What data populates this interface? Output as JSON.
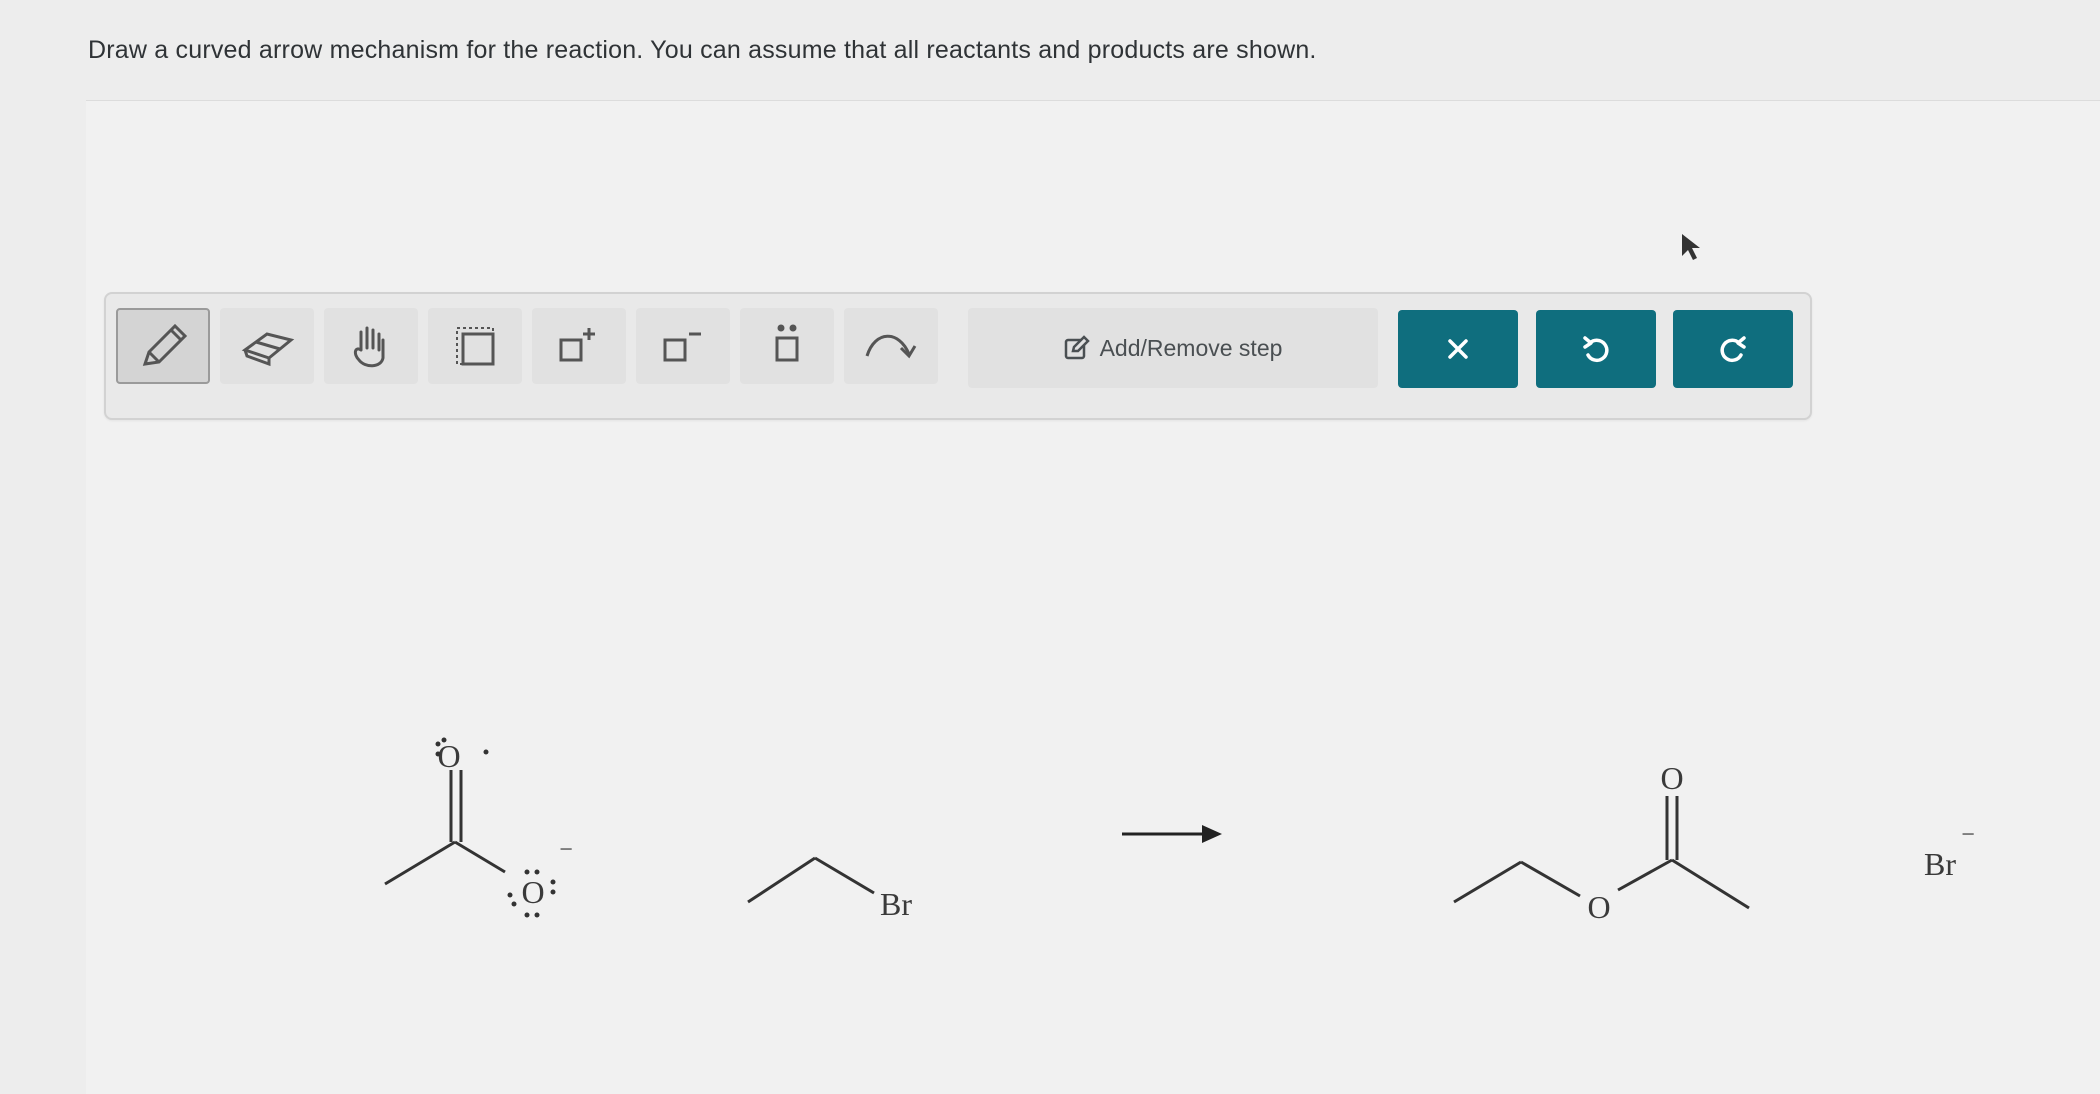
{
  "instructions": "Draw a curved arrow mechanism for the reaction. You can assume that all reactants and products are shown.",
  "toolbar": {
    "tools": [
      {
        "name": "pencil-tool",
        "icon": "pencil-icon"
      },
      {
        "name": "eraser-tool",
        "icon": "eraser-icon"
      },
      {
        "name": "move-tool",
        "icon": "hand-icon"
      },
      {
        "name": "select-tool",
        "icon": "selection-box-icon"
      },
      {
        "name": "positive-charge-tool",
        "icon": "positive-charge-icon"
      },
      {
        "name": "negative-charge-tool",
        "icon": "negative-charge-icon"
      },
      {
        "name": "lone-pair-tool",
        "icon": "lone-pair-icon"
      },
      {
        "name": "curved-arrow-tool",
        "icon": "curved-arrow-icon"
      }
    ],
    "add_remove_step_label": "Add/Remove step",
    "clear_icon": "close-icon",
    "undo_icon": "undo-icon",
    "redo_icon": "redo-icon",
    "accent": "#0f6e7e"
  },
  "reaction": {
    "acetate_oxygen_top": "O",
    "acetate_oxygen_bottom": "O",
    "acetate_charge": "−",
    "ethyl_bromide_atom": "Br",
    "product_carbonyl_oxygen": "O",
    "product_ester_oxygen": "O",
    "bromide_atom": "Br",
    "bromide_charge": "−"
  }
}
